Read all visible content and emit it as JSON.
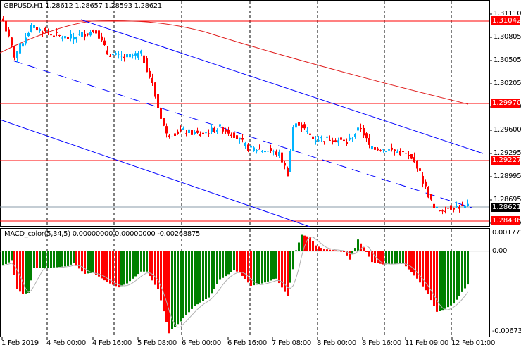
{
  "header": {
    "symbol": "GBPUSD,H1",
    "ohlc": "1.28612 1.28657 1.28593 1.28621"
  },
  "macd": {
    "label": "MACD_color(5,34,5) 0.00000000 0.00000000 -0.00268875",
    "axis": [
      "0.0017710",
      "0.00",
      "-0.006735"
    ]
  },
  "price_axis": [
    "1.31110",
    "1.30805",
    "1.30505",
    "1.30205",
    "1.29900",
    "1.29600",
    "1.29295",
    "1.28995",
    "1.28695",
    "1.28390"
  ],
  "price_tags": {
    "l1": "1.31042",
    "l2": "1.29970",
    "l3": "1.29227",
    "l4": "1.28436",
    "current": "1.28621"
  },
  "time_axis": [
    "1 Feb 2019",
    "4 Feb 00:00",
    "4 Feb 16:00",
    "5 Feb 08:00",
    "6 Feb 00:00",
    "6 Feb 16:00",
    "7 Feb 08:00",
    "8 Feb 00:00",
    "8 Feb 16:00",
    "11 Feb 09:00",
    "12 Feb 01:00"
  ],
  "colors": {
    "bull": "#00b4ff",
    "bear": "#ff0000",
    "macd_up": "#008000",
    "macd_down": "#ff0000",
    "level": "#ff0000",
    "channel": "#0000ff"
  },
  "chart_data": {
    "type": "candlestick",
    "bars": 166,
    "price_anchors": [
      [
        0,
        1.3102
      ],
      [
        4,
        1.3057
      ],
      [
        10,
        1.3095
      ],
      [
        17,
        1.3085
      ],
      [
        23,
        1.308
      ],
      [
        33,
        1.309
      ],
      [
        37,
        1.306
      ],
      [
        43,
        1.3055
      ],
      [
        49,
        1.306
      ],
      [
        53,
        1.302
      ],
      [
        55,
        1.299
      ],
      [
        58,
        1.2955
      ],
      [
        64,
        1.296
      ],
      [
        70,
        1.2955
      ],
      [
        77,
        1.2965
      ],
      [
        82,
        1.2955
      ],
      [
        87,
        1.2938
      ],
      [
        94,
        1.2935
      ],
      [
        98,
        1.293
      ],
      [
        101,
        1.2905
      ],
      [
        103,
        1.2965
      ],
      [
        105,
        1.297
      ],
      [
        110,
        1.295
      ],
      [
        117,
        1.295
      ],
      [
        122,
        1.2945
      ],
      [
        127,
        1.2965
      ],
      [
        130,
        1.294
      ],
      [
        138,
        1.2935
      ],
      [
        143,
        1.293
      ],
      [
        147,
        1.2915
      ],
      [
        149,
        1.2895
      ],
      [
        153,
        1.286
      ],
      [
        155,
        1.2858
      ],
      [
        160,
        1.2862
      ],
      [
        165,
        1.28621
      ]
    ],
    "macd_anchors": [
      [
        0,
        -0.00119
      ],
      [
        3,
        -0.00079
      ],
      [
        5,
        -0.00317
      ],
      [
        7,
        -0.00357
      ],
      [
        9,
        -0.00347
      ],
      [
        11,
        -0.00139
      ],
      [
        16,
        -0.00139
      ],
      [
        23,
        -0.00123
      ],
      [
        25,
        -0.00099
      ],
      [
        29,
        -0.00188
      ],
      [
        32,
        -0.00178
      ],
      [
        37,
        -0.00258
      ],
      [
        41,
        -0.00301
      ],
      [
        44,
        -0.00268
      ],
      [
        49,
        -0.00169
      ],
      [
        51,
        -0.00169
      ],
      [
        55,
        -0.00317
      ],
      [
        59,
        -0.00684
      ],
      [
        60,
        -0.00653
      ],
      [
        63,
        -0.00585
      ],
      [
        68,
        -0.00456
      ],
      [
        73,
        -0.00386
      ],
      [
        77,
        -0.00238
      ],
      [
        82,
        -0.00159
      ],
      [
        84,
        -0.00178
      ],
      [
        88,
        -0.00288
      ],
      [
        92,
        -0.00268
      ],
      [
        97,
        -0.00228
      ],
      [
        101,
        -0.00376
      ],
      [
        103,
        -0.00149
      ],
      [
        104,
        9e-05
      ],
      [
        106,
        0.00138
      ],
      [
        109,
        0.00119
      ],
      [
        111,
        0.00049
      ],
      [
        114,
        0.00019
      ],
      [
        121,
        0
      ],
      [
        123,
        -0.00069
      ],
      [
        125,
        0.00029
      ],
      [
        126,
        0.00099
      ],
      [
        129,
        0
      ],
      [
        131,
        -0.00089
      ],
      [
        135,
        -0.00109
      ],
      [
        142,
        -0.00099
      ],
      [
        147,
        -0.00228
      ],
      [
        151,
        -0.00357
      ],
      [
        154,
        -0.00505
      ],
      [
        156,
        -0.00495
      ],
      [
        160,
        -0.00436
      ],
      [
        165,
        -0.00277
      ]
    ]
  }
}
